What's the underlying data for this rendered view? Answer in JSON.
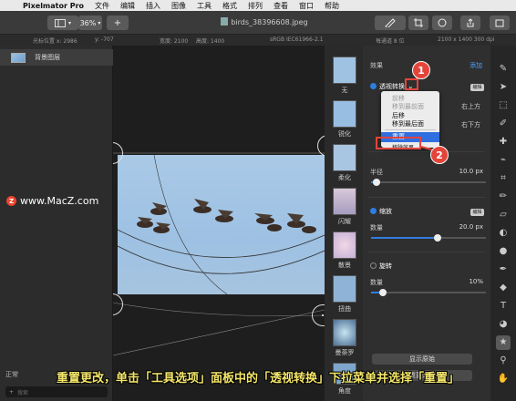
{
  "menubar": {
    "app_name": "Pixelmator Pro",
    "items": [
      "文件",
      "编辑",
      "插入",
      "图像",
      "工具",
      "格式",
      "排列",
      "查看",
      "窗口",
      "帮助"
    ]
  },
  "toolbar": {
    "zoom": "36%",
    "add_label": "+",
    "document_title": "birds_38396608.jpeg"
  },
  "infobar": {
    "cursor_x": "光标位置 x:  2986",
    "cursor_y": "y:  -707",
    "width": "宽度: 2100",
    "height": "高度: 1400",
    "color_profile": "sRGB IEC61966-2.1",
    "depth": "每通道 8 位",
    "dimensions": "2100 x 1400 300 dpi"
  },
  "layers": {
    "layer_name": "背景图层",
    "blend_mode": "正常",
    "search_placeholder": "搜索"
  },
  "watermark": "www.MacZ.com",
  "effects_browser": [
    "无",
    "锐化",
    "柔化",
    "闪耀",
    "散景",
    "扭曲",
    "曼荼罗",
    "角度"
  ],
  "settings": {
    "header": "效果",
    "add": "添加",
    "perspective_label": "透视转换",
    "perspective_badge": "编辑",
    "partial_right_1": "右上方",
    "partial_right_2": "右下方",
    "radius_label": "半径",
    "radius_value": "10.0 px",
    "radius_fraction": 0.05,
    "zoom_label": "缩放",
    "zoom_badge": "编辑",
    "zoom_amount_label": "数量",
    "zoom_amount_value": "20.0 px",
    "zoom_fraction": 0.58,
    "twirl_label": "旋转",
    "twirl_amount_label": "数量",
    "twirl_amount_value": "10%",
    "twirl_fraction": 0.1,
    "btn_show_original": "显示原始",
    "btn_reset": "重置效果"
  },
  "dropdown": {
    "items": [
      "前移",
      "移到最前面",
      "后移",
      "移到最后面"
    ],
    "reset": "重置",
    "remove": "移除效果"
  },
  "markers": {
    "m1": "1",
    "m2": "2"
  },
  "caption": "重置更改，单击「工具选项」面板中的「透视转换」下拉菜单并选择「重置」",
  "colors": {
    "accent": "#2f7de1",
    "annotation": "#e4443a",
    "caption": "#f4e66a"
  }
}
